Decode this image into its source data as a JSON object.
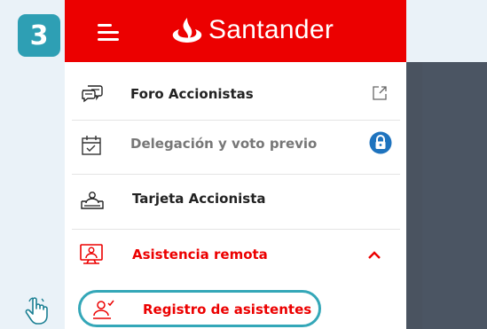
{
  "step": {
    "number": "3"
  },
  "header": {
    "brand": "Santander",
    "menu_icon": "hamburger-icon",
    "logo_icon": "santander-flame-icon"
  },
  "menu": {
    "items": [
      {
        "label": "Foro Accionistas",
        "icon": "chat-bubbles-icon",
        "right_icon": "external-link-icon"
      },
      {
        "label": "Delegación y voto previo",
        "icon": "calendar-check-icon",
        "right_icon": "lock-icon",
        "disabled": true
      },
      {
        "label": "Tarjeta Accionista",
        "icon": "id-card-icon"
      },
      {
        "label": "Asistencia remota",
        "icon": "monitor-user-icon",
        "right_icon": "chevron-up-icon",
        "active": true
      }
    ],
    "submenu": [
      {
        "label": "Registro de asistentes",
        "icon": "user-check-icon",
        "highlighted": true
      }
    ]
  },
  "colors": {
    "brand_red": "#ec0000",
    "accent_teal": "#2e9fb4",
    "disabled_text": "#777777",
    "dark_overlay": "#4b5563"
  },
  "pointer": {
    "icon": "pointing-hand-icon"
  }
}
